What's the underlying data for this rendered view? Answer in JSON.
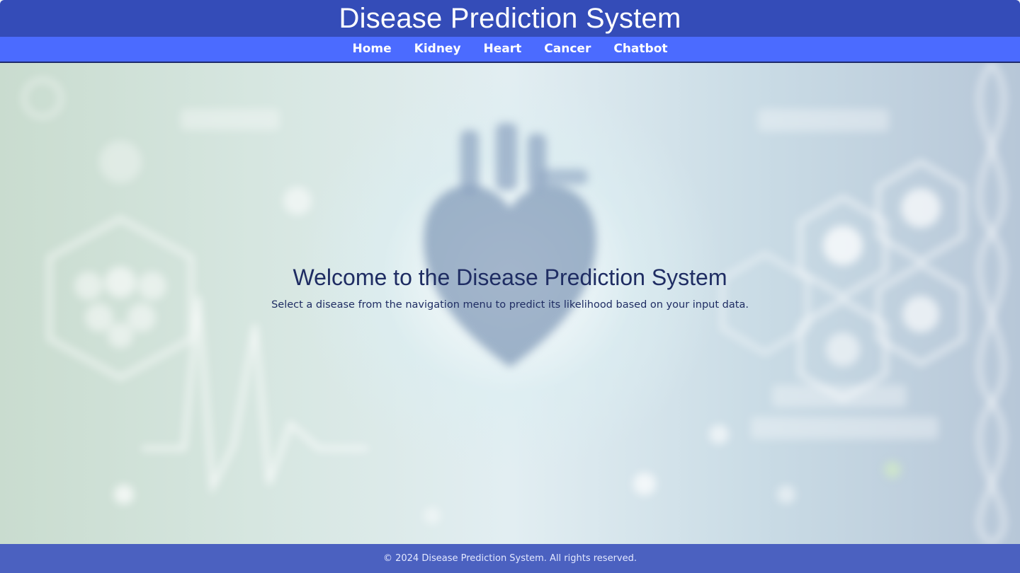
{
  "header": {
    "title": "Disease Prediction System"
  },
  "nav": {
    "items": [
      {
        "label": "Home"
      },
      {
        "label": "Kidney"
      },
      {
        "label": "Heart"
      },
      {
        "label": "Cancer"
      },
      {
        "label": "Chatbot"
      }
    ]
  },
  "hero": {
    "title": "Welcome to the Disease Prediction System",
    "subtitle": "Select a disease from the navigation menu to predict its likelihood based on your input data.",
    "background_labels": [
      "HEART",
      "KIDNEYS",
      "DISEASE",
      "PREDICTION"
    ]
  },
  "footer": {
    "text": "© 2024 Disease Prediction System. All rights reserved."
  },
  "colors": {
    "header_bg": "#344cb8",
    "nav_bg": "#4b6bff",
    "hero_text": "#1f2d63"
  }
}
